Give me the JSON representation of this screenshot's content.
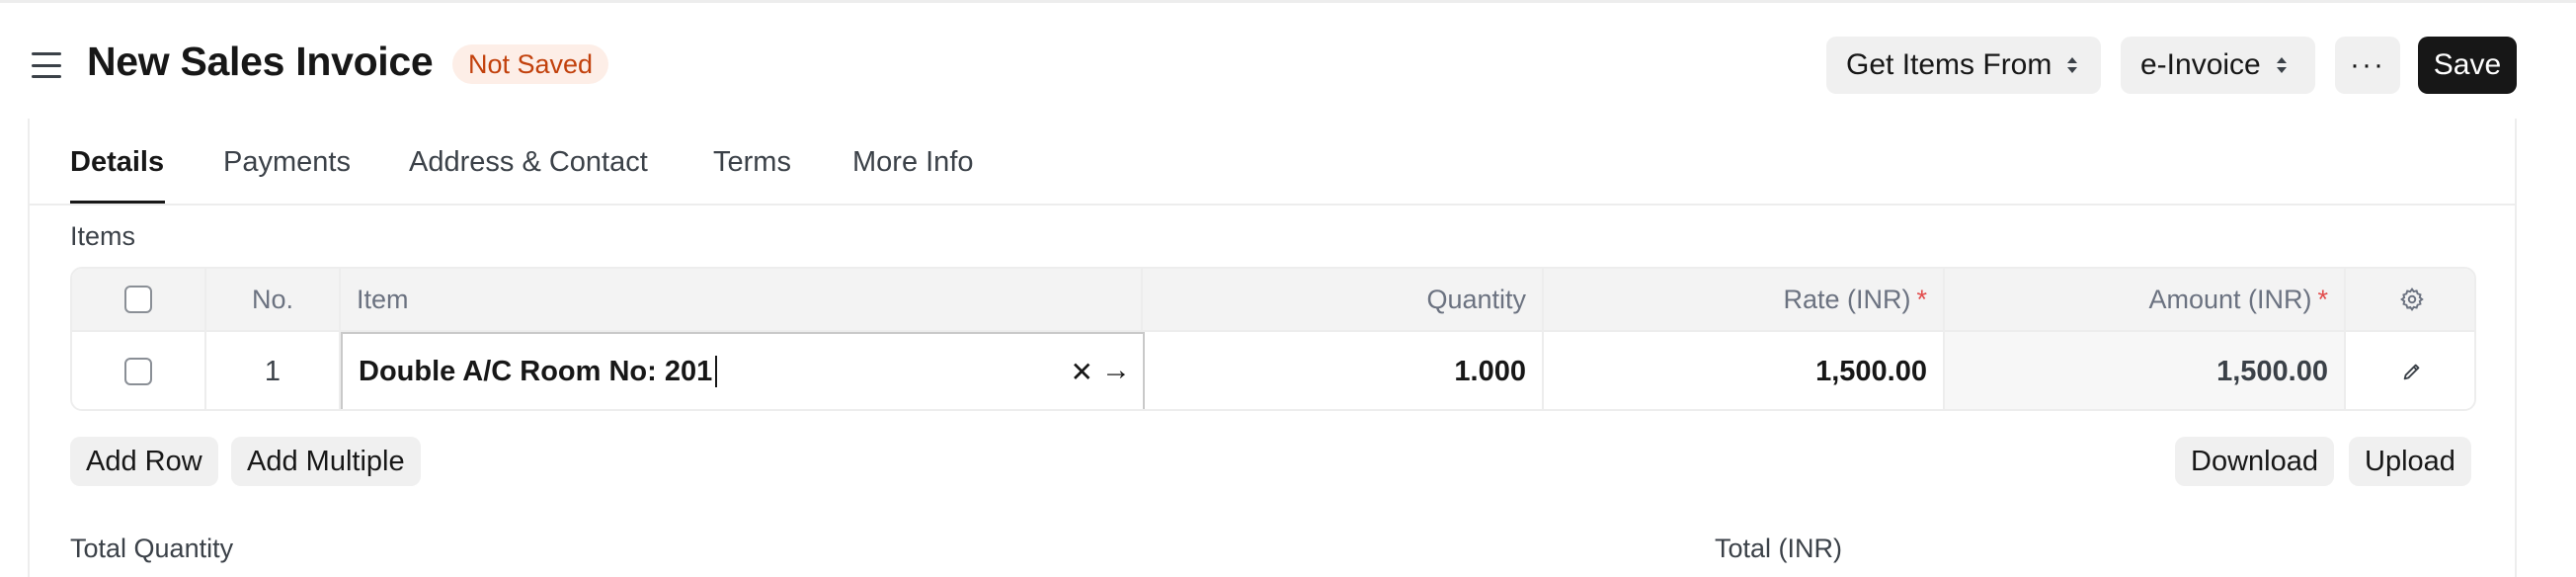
{
  "header": {
    "title": "New Sales Invoice",
    "status_badge": "Not Saved",
    "get_items_label": "Get Items From",
    "einvoice_label": "e-Invoice",
    "more_label": "···",
    "save_label": "Save"
  },
  "tabs": [
    {
      "label": "Details",
      "active": true
    },
    {
      "label": "Payments",
      "active": false
    },
    {
      "label": "Address & Contact",
      "active": false
    },
    {
      "label": "Terms",
      "active": false
    },
    {
      "label": "More Info",
      "active": false
    }
  ],
  "items": {
    "section_label": "Items",
    "columns": {
      "no": "No.",
      "item": "Item",
      "quantity": "Quantity",
      "rate": "Rate (INR)",
      "amount": "Amount (INR)",
      "required_marker": "*"
    },
    "rows": [
      {
        "no": "1",
        "item": "Double A/C Room No: 201",
        "quantity": "1.000",
        "rate": "1,500.00",
        "amount": "1,500.00"
      }
    ],
    "add_row_label": "Add Row",
    "add_multiple_label": "Add Multiple",
    "download_label": "Download",
    "upload_label": "Upload"
  },
  "totals": {
    "total_quantity_label": "Total Quantity",
    "total_inr_label": "Total (INR)"
  },
  "colors": {
    "primary_button": "#171717",
    "badge_bg": "#fdeee7",
    "badge_text": "#c2410c",
    "required": "#e24c4c"
  }
}
